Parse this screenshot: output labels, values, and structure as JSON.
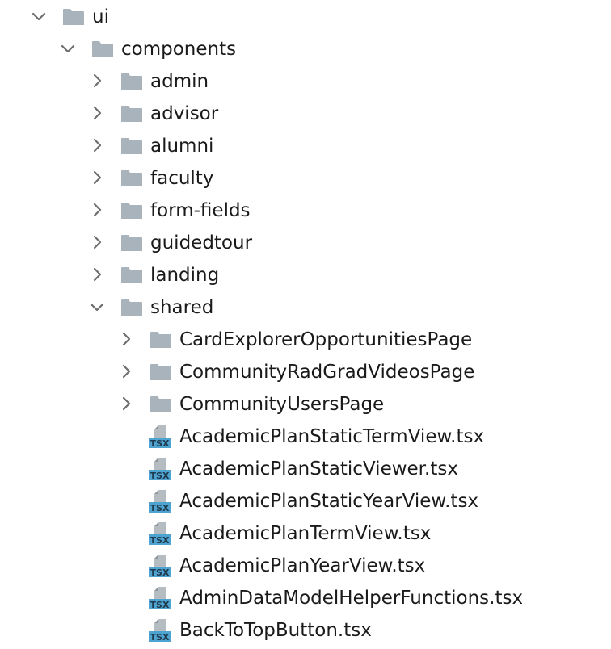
{
  "tree": {
    "root": {
      "label": "ui",
      "expanded": true
    },
    "components": {
      "label": "components",
      "expanded": true
    },
    "component_folders": [
      {
        "label": "admin",
        "expanded": false
      },
      {
        "label": "advisor",
        "expanded": false
      },
      {
        "label": "alumni",
        "expanded": false
      },
      {
        "label": "faculty",
        "expanded": false
      },
      {
        "label": "form-fields",
        "expanded": false
      },
      {
        "label": "guidedtour",
        "expanded": false
      },
      {
        "label": "landing",
        "expanded": false
      },
      {
        "label": "shared",
        "expanded": true
      }
    ],
    "shared_folders": [
      {
        "label": "CardExplorerOpportunitiesPage",
        "expanded": false
      },
      {
        "label": "CommunityRadGradVideosPage",
        "expanded": false
      },
      {
        "label": "CommunityUsersPage",
        "expanded": false
      }
    ],
    "shared_files": [
      {
        "label": "AcademicPlanStaticTermView.tsx",
        "icon": "tsx-file-icon"
      },
      {
        "label": "AcademicPlanStaticViewer.tsx",
        "icon": "tsx-file-icon"
      },
      {
        "label": "AcademicPlanStaticYearView.tsx",
        "icon": "tsx-file-icon"
      },
      {
        "label": "AcademicPlanTermView.tsx",
        "icon": "tsx-file-icon"
      },
      {
        "label": "AcademicPlanYearView.tsx",
        "icon": "tsx-file-icon"
      },
      {
        "label": "AdminDataModelHelperFunctions.tsx",
        "icon": "tsx-file-icon"
      },
      {
        "label": "BackToTopButton.tsx",
        "icon": "tsx-file-icon"
      }
    ],
    "file_badge_text": "TSX"
  },
  "colors": {
    "folder": "#a9b3bb",
    "chevron": "#6e6e6e",
    "text": "#1a1a1a",
    "tsx_badge": "#4fa3d1"
  }
}
